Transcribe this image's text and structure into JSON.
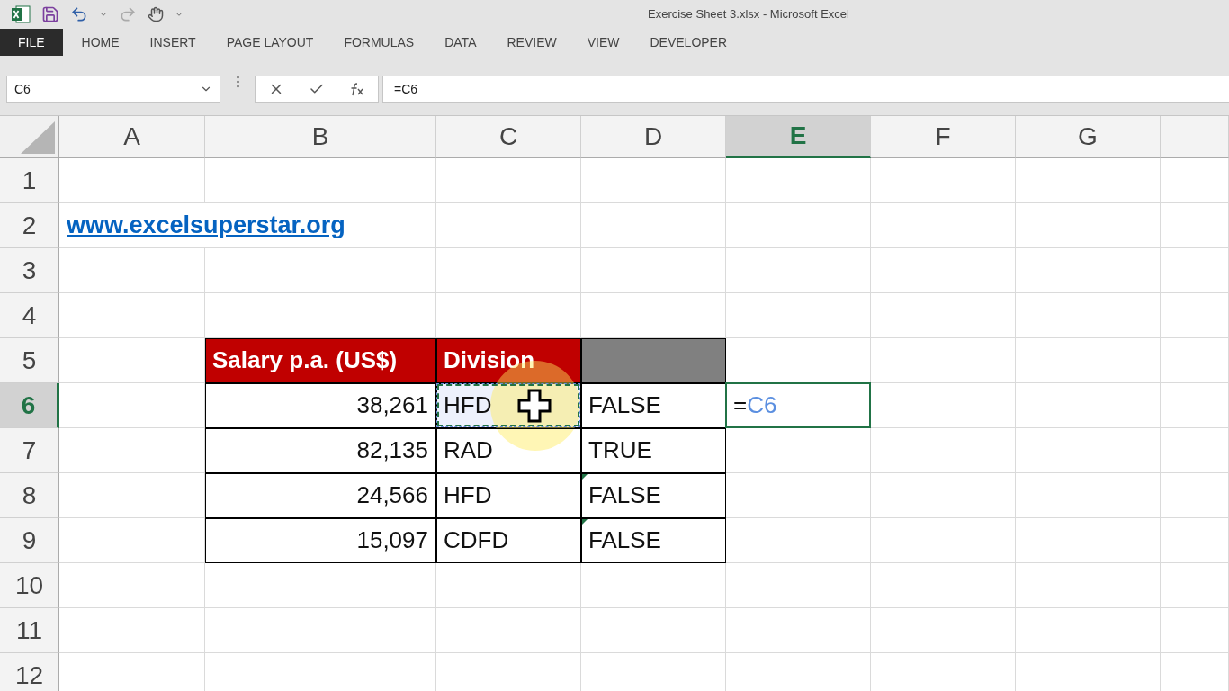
{
  "window": {
    "title": "Exercise Sheet 3.xlsx - Microsoft Excel"
  },
  "ribbon_tabs": [
    {
      "label": "FILE",
      "selected": true
    },
    {
      "label": "HOME",
      "selected": false
    },
    {
      "label": "INSERT",
      "selected": false
    },
    {
      "label": "PAGE LAYOUT",
      "selected": false
    },
    {
      "label": "FORMULAS",
      "selected": false
    },
    {
      "label": "DATA",
      "selected": false
    },
    {
      "label": "REVIEW",
      "selected": false
    },
    {
      "label": "VIEW",
      "selected": false
    },
    {
      "label": "DEVELOPER",
      "selected": false
    }
  ],
  "formula_bar": {
    "name_box": "C6",
    "formula": "=C6"
  },
  "columns": [
    {
      "label": "A",
      "selected": false
    },
    {
      "label": "B",
      "selected": false
    },
    {
      "label": "C",
      "selected": false
    },
    {
      "label": "D",
      "selected": false
    },
    {
      "label": "E",
      "selected": true
    },
    {
      "label": "F",
      "selected": false
    },
    {
      "label": "G",
      "selected": false
    }
  ],
  "rows": [
    {
      "number": "1",
      "selected": false
    },
    {
      "number": "2",
      "selected": false,
      "cells": [
        {
          "kind": "link",
          "value": "www.excelsuperstar.org"
        }
      ]
    },
    {
      "number": "3",
      "selected": false
    },
    {
      "number": "4",
      "selected": false
    },
    {
      "number": "5",
      "selected": false,
      "cells": [
        {
          "kind": "empty"
        },
        {
          "kind": "header",
          "value": "Salary p.a. (US$)"
        },
        {
          "kind": "header",
          "value": "Division"
        },
        {
          "kind": "blank-header"
        }
      ]
    },
    {
      "number": "6",
      "selected": true,
      "cells": [
        {
          "kind": "empty"
        },
        {
          "kind": "number",
          "value": "38,261"
        },
        {
          "kind": "text",
          "value": "HFD",
          "copy_source": true
        },
        {
          "kind": "text",
          "value": "FALSE"
        },
        {
          "kind": "formula",
          "value": "=",
          "reference": "C6",
          "active": true
        }
      ]
    },
    {
      "number": "7",
      "selected": false,
      "cells": [
        {
          "kind": "empty"
        },
        {
          "kind": "number",
          "value": "82,135"
        },
        {
          "kind": "text",
          "value": "RAD"
        },
        {
          "kind": "text",
          "value": "TRUE"
        }
      ]
    },
    {
      "number": "8",
      "selected": false,
      "cells": [
        {
          "kind": "empty"
        },
        {
          "kind": "number",
          "value": "24,566"
        },
        {
          "kind": "text",
          "value": "HFD"
        },
        {
          "kind": "text",
          "value": "FALSE",
          "error_flag": true
        }
      ]
    },
    {
      "number": "9",
      "selected": false,
      "cells": [
        {
          "kind": "empty"
        },
        {
          "kind": "number",
          "value": "15,097"
        },
        {
          "kind": "text",
          "value": "CDFD"
        },
        {
          "kind": "text",
          "value": "FALSE",
          "error_flag": true
        }
      ]
    },
    {
      "number": "10",
      "selected": false
    },
    {
      "number": "11",
      "selected": false
    },
    {
      "number": "12",
      "selected": false
    }
  ]
}
